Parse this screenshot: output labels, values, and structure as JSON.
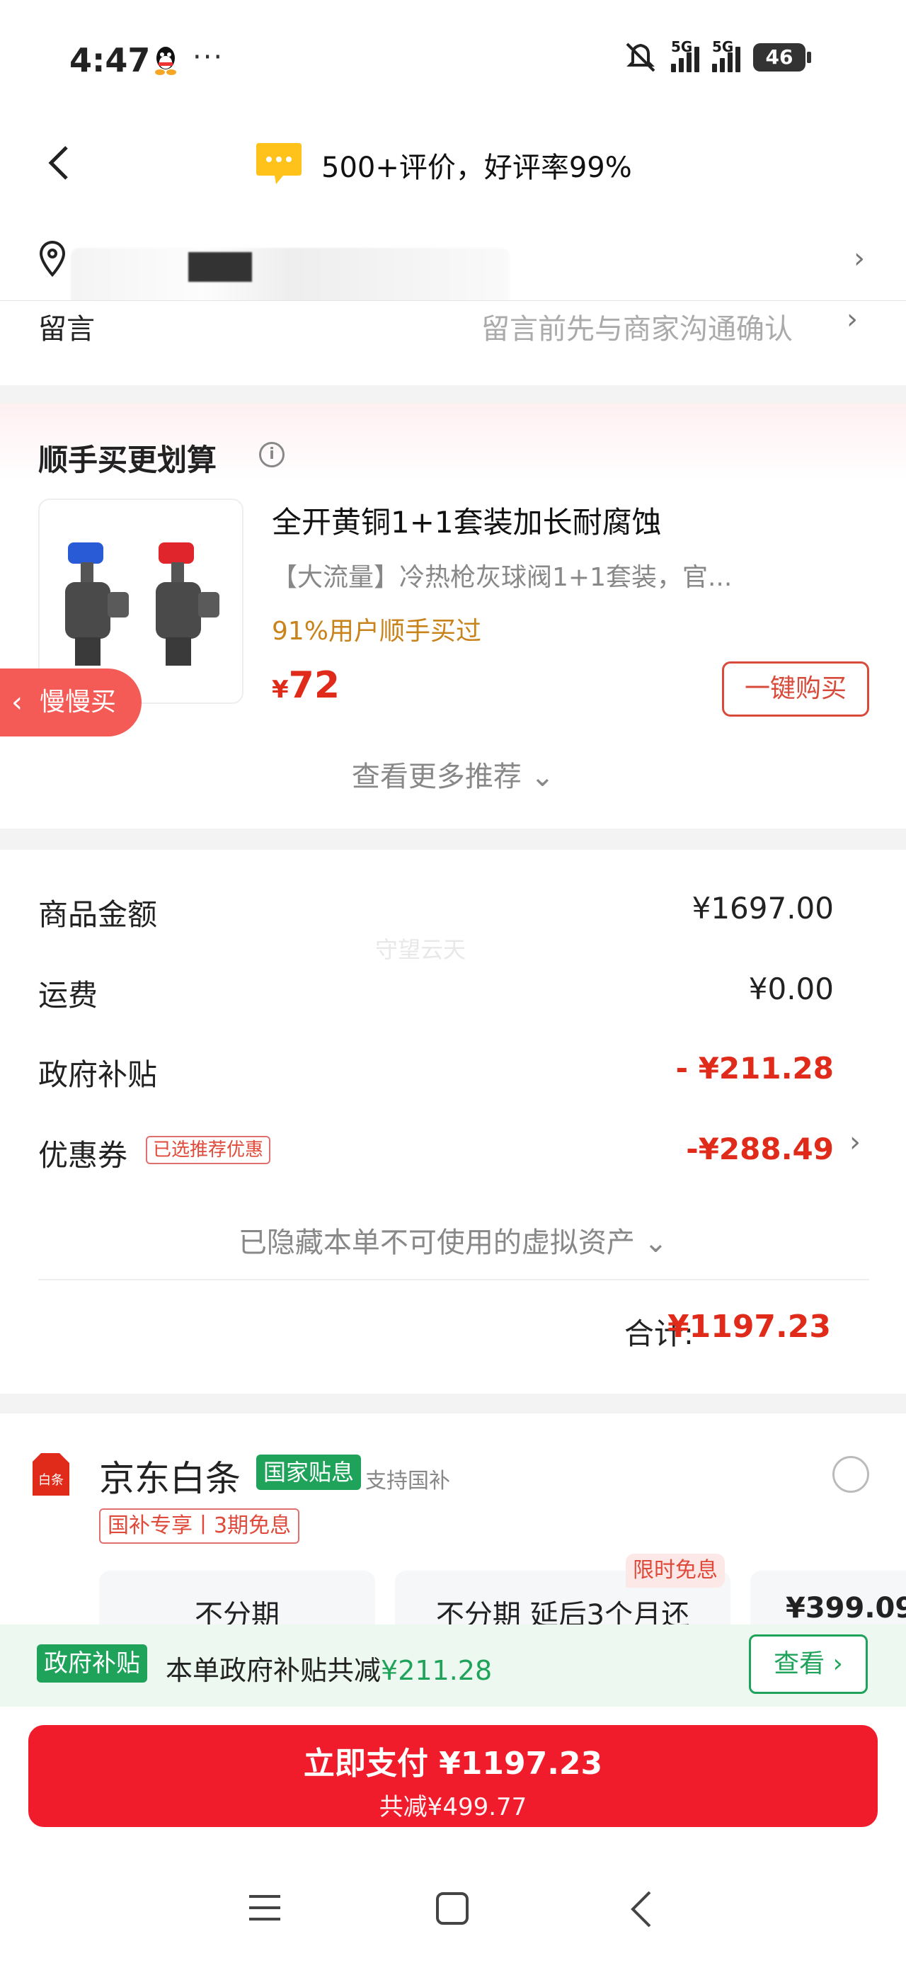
{
  "status_bar": {
    "time": "4:47",
    "more": "···",
    "signal1": "5G",
    "signal2": "5G",
    "battery": "46"
  },
  "header": {
    "title": "500+评价，好评率99%"
  },
  "message": {
    "label": "留言",
    "placeholder": "留言前先与商家沟通确认"
  },
  "recommend": {
    "title": "顺手买更划算",
    "product": {
      "title": "全开黄铜1+1套装加长耐腐蚀",
      "subtitle": "【大流量】冷热枪灰球阀1+1套装，官...",
      "percent": "91%用户顺手买过",
      "currency": "¥",
      "price": "72",
      "buy_label": "一键购买"
    },
    "slow_buy": "慢慢买",
    "more": "查看更多推荐 ⌄"
  },
  "totals": {
    "watermark": "守望云天",
    "rows": [
      {
        "label": "商品金额",
        "value": "¥1697.00"
      },
      {
        "label": "运费",
        "value": "¥0.00"
      },
      {
        "label": "政府补贴",
        "value": "- ¥211.28"
      },
      {
        "label": "优惠券",
        "value": "-¥288.49"
      }
    ],
    "coupon_tag": "已选推荐优惠",
    "hidden_assets": "已隐藏本单不可使用的虚拟资产 ⌄",
    "total_label": "合计:",
    "total_value": "¥1197.23"
  },
  "payment": {
    "name": "京东白条",
    "tag_green": "国家贴息",
    "support": "支持国补",
    "tag_red": "国补专享丨3期免息",
    "plans": [
      "不分期",
      "不分期 延后3个月还",
      "¥399.09"
    ],
    "limited": "限时免息",
    "logo_text": "白条"
  },
  "gov_bar": {
    "tag": "政府补贴",
    "text": "本单政府补贴共减",
    "amount": "¥211.28",
    "button": "查看 ›"
  },
  "pay_button": {
    "main": "立即支付 ¥1197.23",
    "sub": "共减¥499.77"
  },
  "colors": {
    "brand_red": "#f01c2c",
    "green": "#1fa35a",
    "orange": "#c9831b"
  }
}
